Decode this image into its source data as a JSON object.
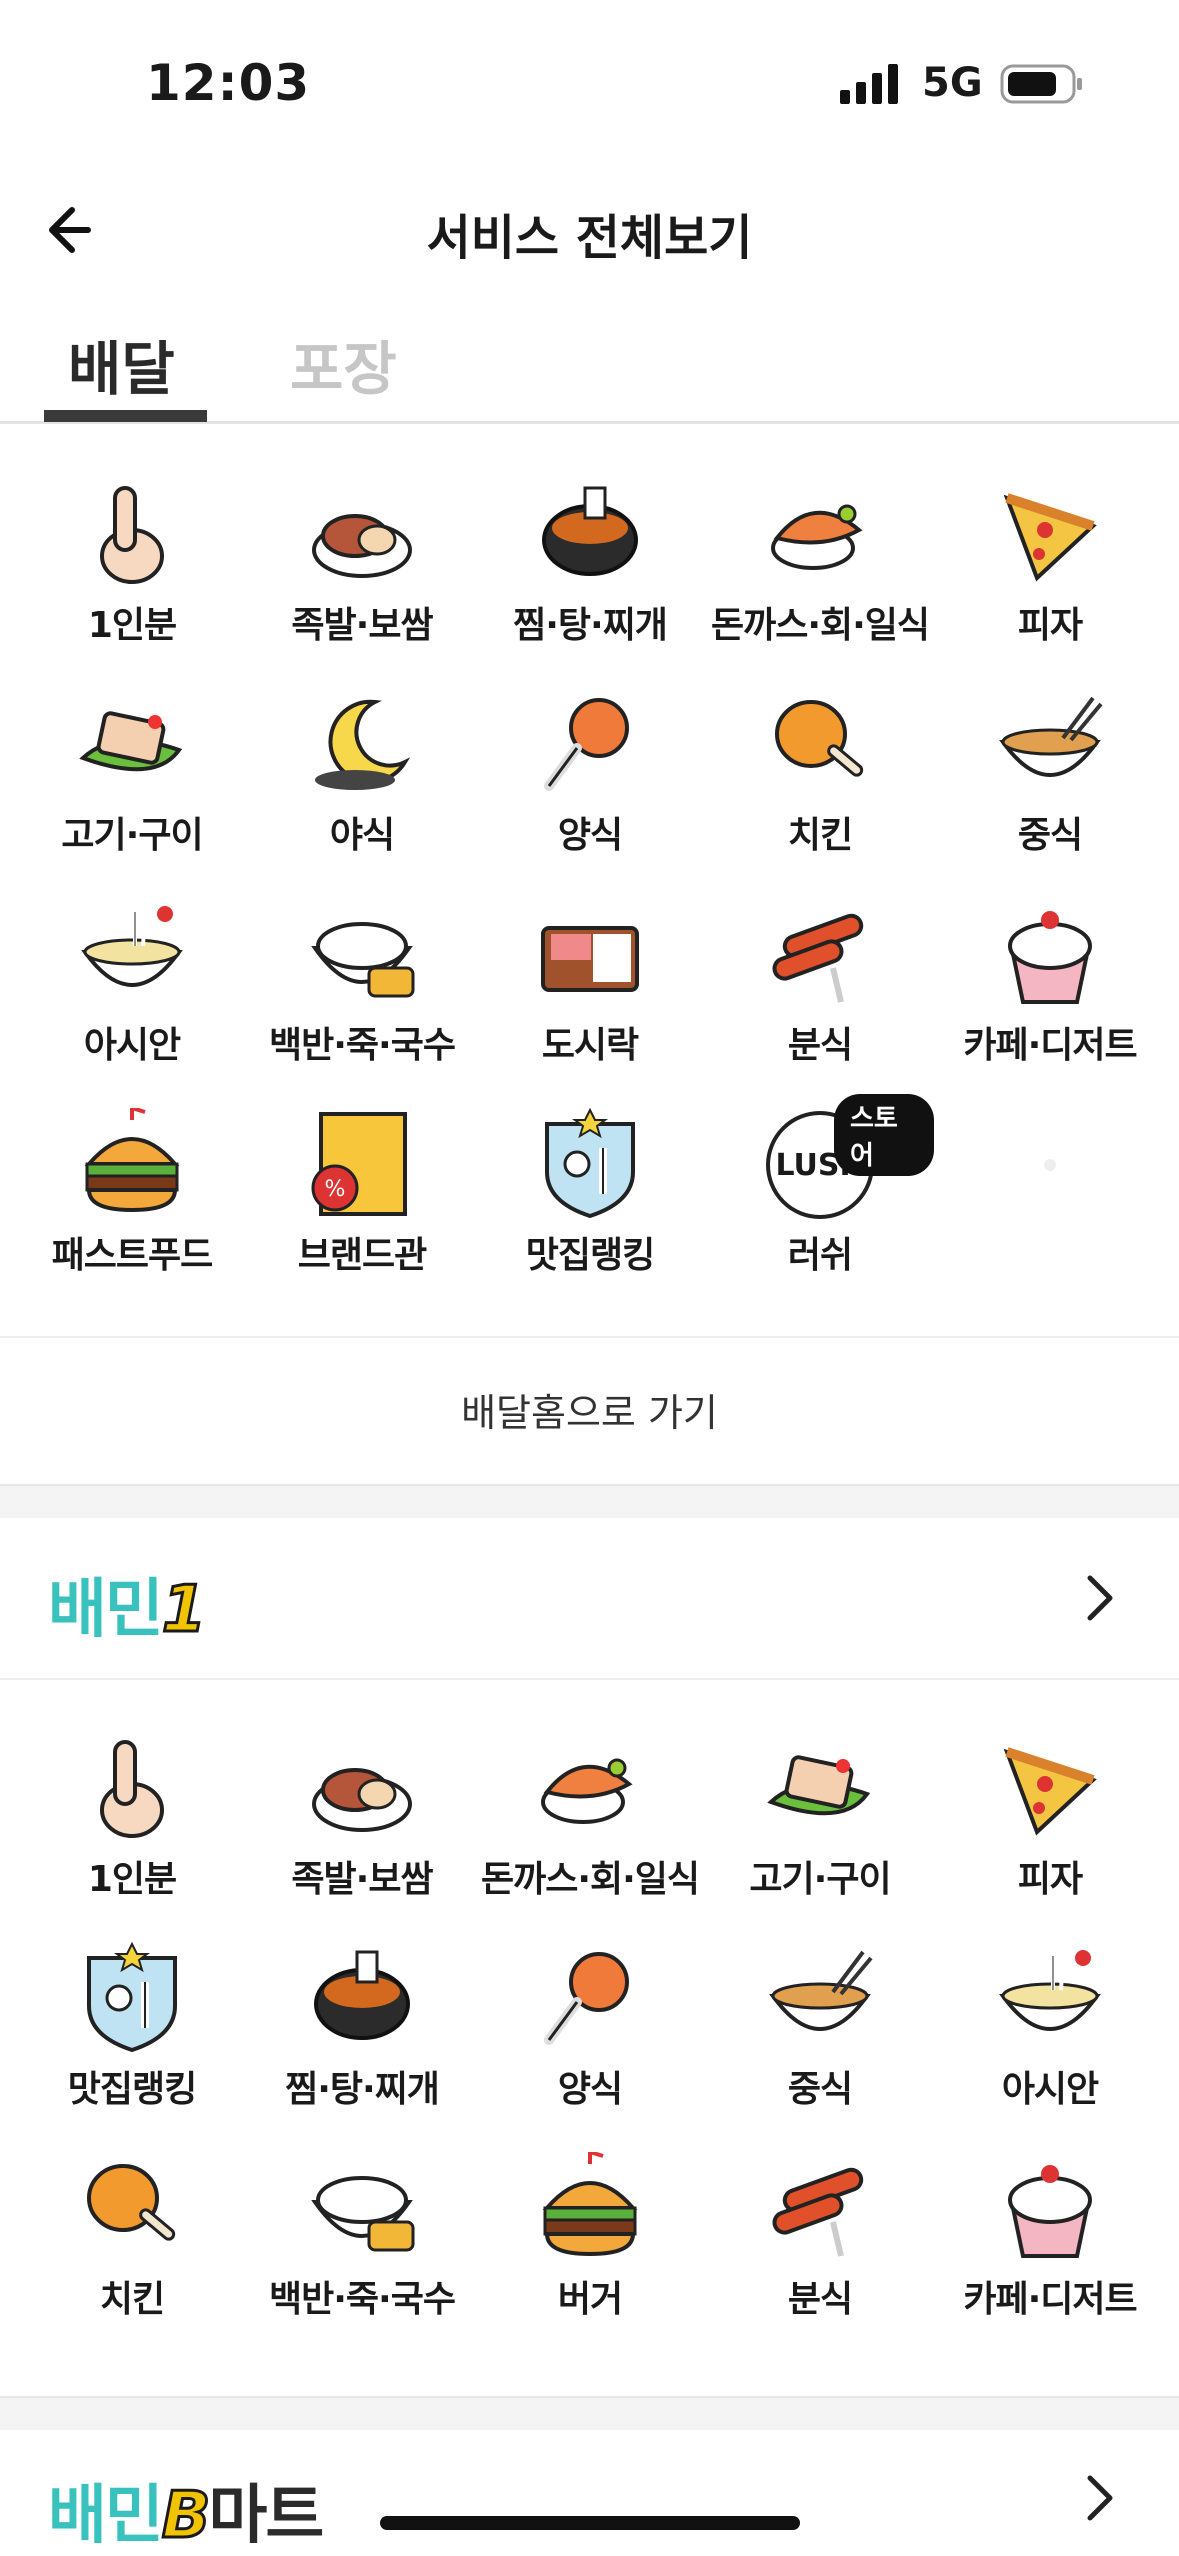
{
  "status": {
    "time": "12:03",
    "network": "5G"
  },
  "header": {
    "title": "서비스 전체보기"
  },
  "tabs": [
    {
      "label": "배달",
      "active": true
    },
    {
      "label": "포장",
      "active": false
    }
  ],
  "delivery": {
    "items": [
      {
        "label": "1인분",
        "icon": "hand-one-icon"
      },
      {
        "label": "족발·보쌈",
        "icon": "jokbal-icon"
      },
      {
        "label": "찜·탕·찌개",
        "icon": "stew-pot-icon"
      },
      {
        "label": "돈까스·회·일식",
        "icon": "sushi-icon"
      },
      {
        "label": "피자",
        "icon": "pizza-icon"
      },
      {
        "label": "고기·구이",
        "icon": "grilled-meat-icon"
      },
      {
        "label": "야식",
        "icon": "moon-icon"
      },
      {
        "label": "양식",
        "icon": "pasta-fork-icon"
      },
      {
        "label": "치킨",
        "icon": "chicken-leg-icon"
      },
      {
        "label": "중식",
        "icon": "noodle-bowl-icon"
      },
      {
        "label": "아시안",
        "icon": "pho-bowl-icon"
      },
      {
        "label": "백반·죽·국수",
        "icon": "rice-bowl-icon"
      },
      {
        "label": "도시락",
        "icon": "lunchbox-icon"
      },
      {
        "label": "분식",
        "icon": "tteokbokki-icon"
      },
      {
        "label": "카페·디저트",
        "icon": "cupcake-icon"
      },
      {
        "label": "패스트푸드",
        "icon": "burger-icon"
      },
      {
        "label": "브랜드관",
        "icon": "brand-sticker-icon"
      },
      {
        "label": "맛집랭킹",
        "icon": "ranking-badge-icon"
      },
      {
        "label": "러쉬",
        "icon": "lush-logo-icon",
        "badge": "스토어",
        "logo_text": "LUSH"
      },
      {
        "label": "",
        "icon": "blank-icon"
      }
    ],
    "home_link": "배달홈으로 가기"
  },
  "baemin1": {
    "title": "배민",
    "title_num": "1",
    "items": [
      {
        "label": "1인분",
        "icon": "hand-one-icon"
      },
      {
        "label": "족발·보쌈",
        "icon": "jokbal-icon"
      },
      {
        "label": "돈까스·회·일식",
        "icon": "sushi-icon"
      },
      {
        "label": "고기·구이",
        "icon": "grilled-meat-icon"
      },
      {
        "label": "피자",
        "icon": "pizza-icon"
      },
      {
        "label": "맛집랭킹",
        "icon": "ranking-badge-icon"
      },
      {
        "label": "찜·탕·찌개",
        "icon": "stew-pot-icon"
      },
      {
        "label": "양식",
        "icon": "pasta-fork-icon"
      },
      {
        "label": "중식",
        "icon": "noodle-bowl-icon"
      },
      {
        "label": "아시안",
        "icon": "pho-bowl-icon"
      },
      {
        "label": "치킨",
        "icon": "chicken-leg-icon"
      },
      {
        "label": "백반·죽·국수",
        "icon": "rice-bowl-icon"
      },
      {
        "label": "버거",
        "icon": "burger-icon"
      },
      {
        "label": "분식",
        "icon": "tteokbokki-icon"
      },
      {
        "label": "카페·디저트",
        "icon": "cupcake-icon"
      }
    ]
  },
  "bmart": {
    "title": "배민",
    "title_num": "B",
    "title_suffix": "마트"
  },
  "colors": {
    "brand_mint": "#39c2bd",
    "brand_yellow": "#f2c300",
    "tab_inactive": "#c6c6c6"
  }
}
